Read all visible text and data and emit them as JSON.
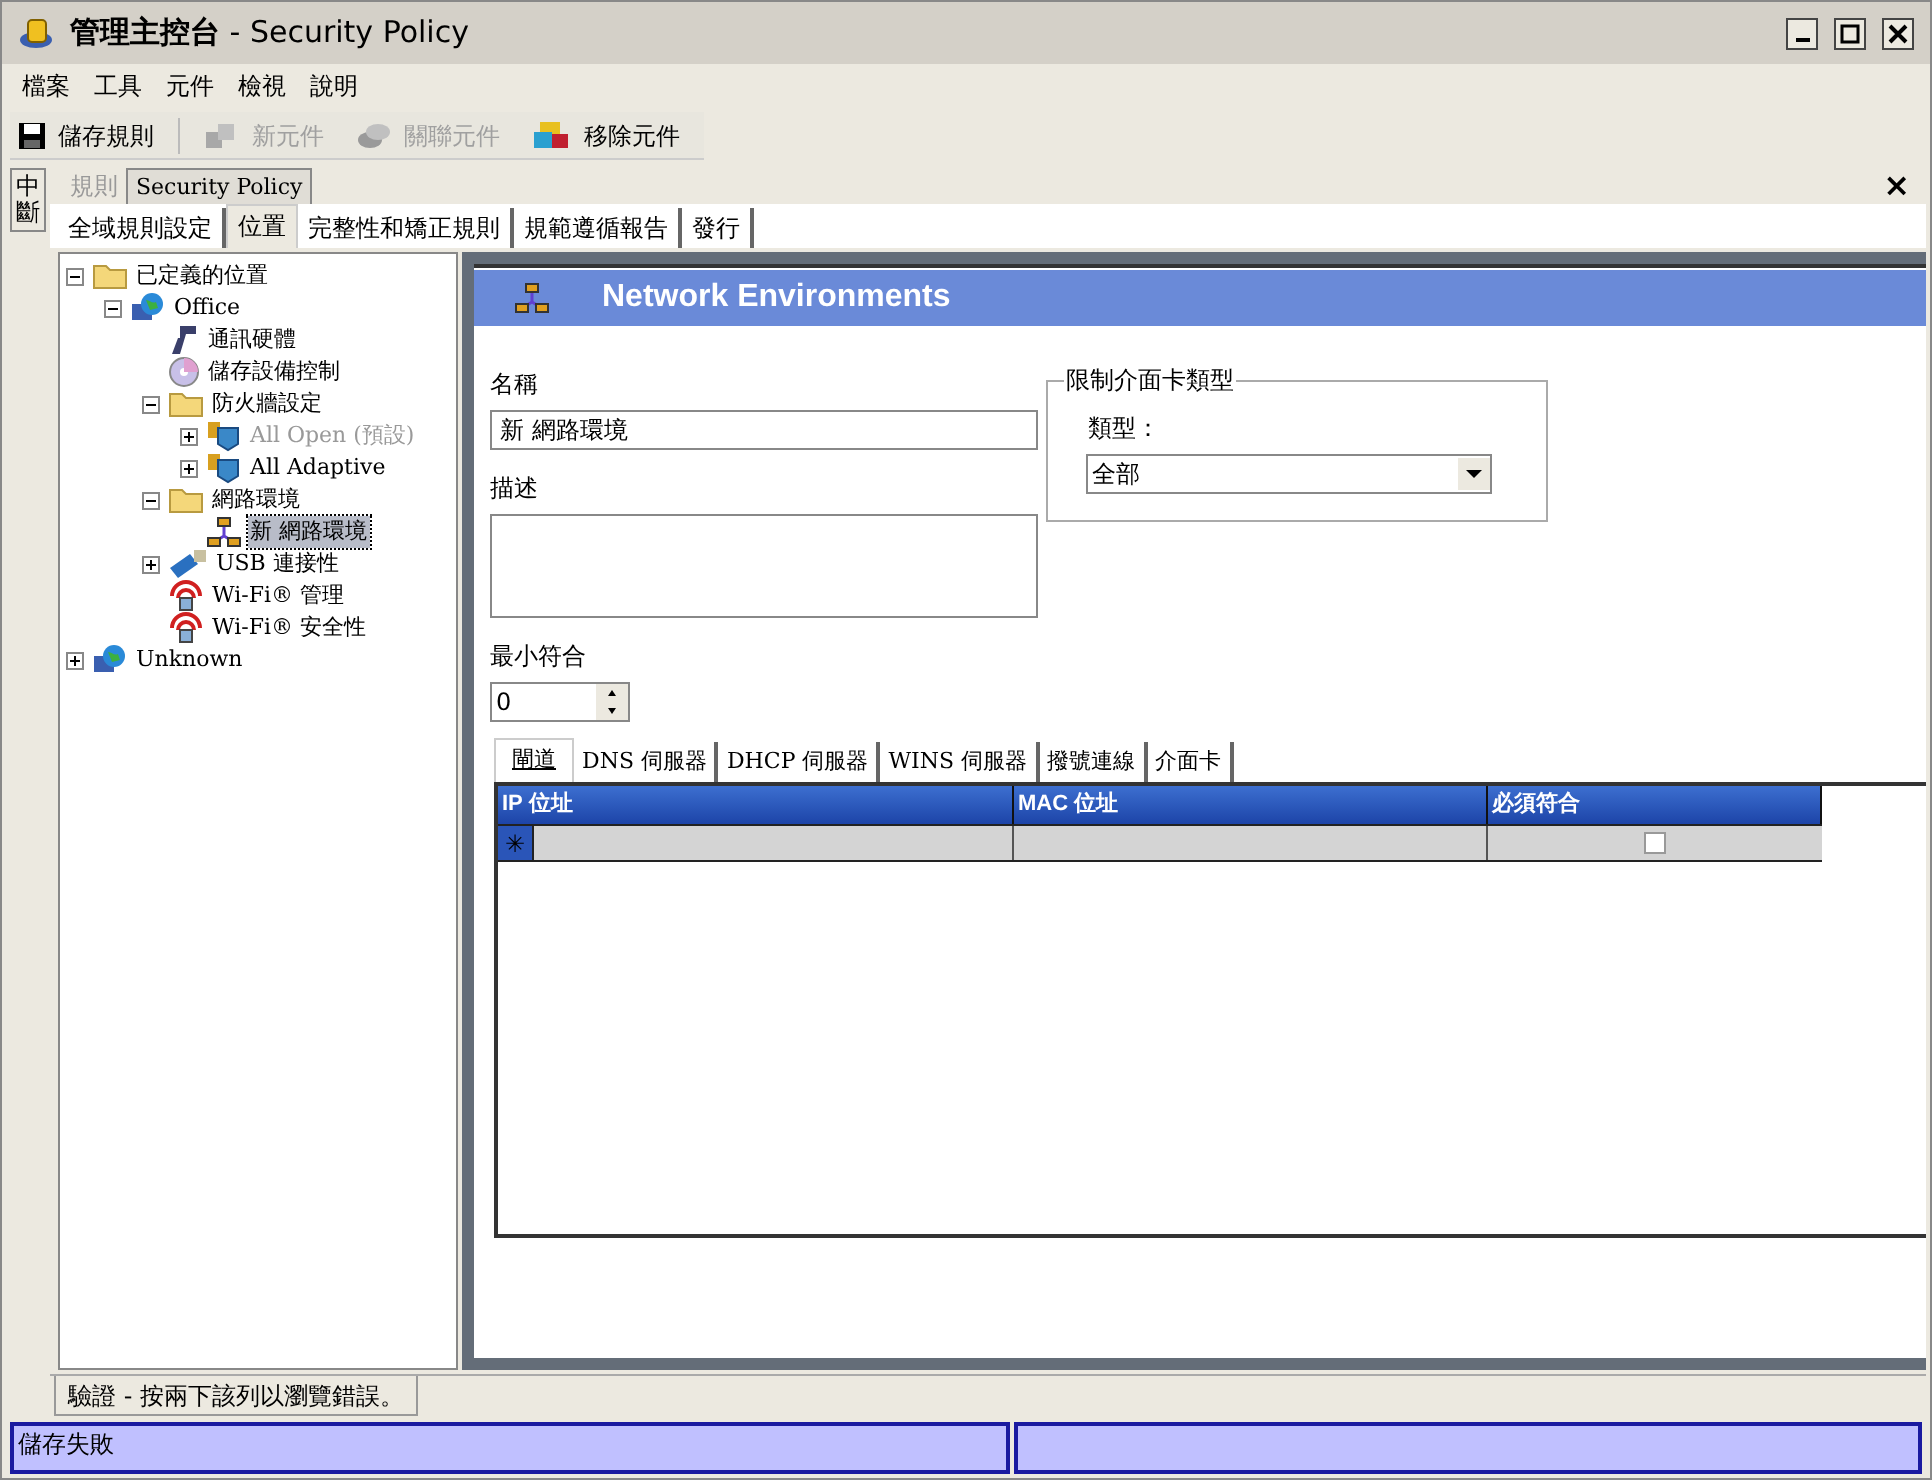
{
  "window": {
    "title_main": "管理主控台",
    "title_rest": "- Security Policy"
  },
  "menu": [
    "檔案",
    "工具",
    "元件",
    "檢視",
    "說明"
  ],
  "toolbar": [
    {
      "kind": "save",
      "label": "儲存規則",
      "disabled": false
    },
    {
      "kind": "new",
      "label": "新元件",
      "disabled": true
    },
    {
      "kind": "link",
      "label": "關聯元件",
      "disabled": true
    },
    {
      "kind": "remove",
      "label": "移除元件",
      "disabled": false
    }
  ],
  "side_tab": "中斷",
  "document_tabs": [
    {
      "label": "規則",
      "selected": false
    },
    {
      "label": "Security Policy",
      "selected": true
    }
  ],
  "close_glyph": "×",
  "tabs": [
    {
      "label": "全域規則設定",
      "selected": false
    },
    {
      "label": "位置",
      "selected": true
    },
    {
      "label": "完整性和矯正規則",
      "selected": false
    },
    {
      "label": "規範遵循報告",
      "selected": false
    },
    {
      "label": "發行",
      "selected": false
    }
  ],
  "tree": [
    {
      "kind": "folder",
      "label": "已定義的位置",
      "expanded": true,
      "selected": false,
      "disabled": false,
      "children": [
        {
          "kind": "globe",
          "label": "Office",
          "expanded": true,
          "selected": false,
          "disabled": false,
          "children": [
            {
              "kind": "device",
              "label": "通訊硬體",
              "selected": false,
              "disabled": false
            },
            {
              "kind": "disc",
              "label": "儲存設備控制",
              "selected": false,
              "disabled": false
            },
            {
              "kind": "folder",
              "label": "防火牆設定",
              "expanded": true,
              "selected": false,
              "disabled": false,
              "children": [
                {
                  "kind": "firewall",
                  "label": "All Open (預設)",
                  "expanded": false,
                  "selected": false,
                  "disabled": true
                },
                {
                  "kind": "firewall",
                  "label": "All Adaptive",
                  "expanded": false,
                  "selected": false,
                  "disabled": false
                }
              ]
            },
            {
              "kind": "folder",
              "label": "網路環境",
              "expanded": true,
              "selected": false,
              "disabled": false,
              "children": [
                {
                  "kind": "network",
                  "label": "新 網路環境",
                  "selected": true,
                  "disabled": false
                }
              ]
            },
            {
              "kind": "usb",
              "label": "USB 連接性",
              "expanded": false,
              "selected": false,
              "disabled": false
            },
            {
              "kind": "wifi",
              "label": "Wi-Fi® 管理",
              "selected": false,
              "disabled": false
            },
            {
              "kind": "wifi",
              "label": "Wi-Fi® 安全性",
              "selected": false,
              "disabled": false
            }
          ]
        }
      ]
    },
    {
      "kind": "globe",
      "label": "Unknown",
      "expanded": false,
      "selected": false,
      "disabled": false
    }
  ],
  "panel": {
    "title": "Network Environments",
    "name_label": "名稱",
    "name_value": "新 網路環境",
    "description_label": "描述",
    "min_match_label": "最小符合",
    "min_match_value": "0",
    "nic_group": {
      "title": "限制介面卡類型",
      "type_label": "類型：",
      "type_value": "全部"
    },
    "sub_tabs": [
      {
        "label": "閘道",
        "selected": true
      },
      {
        "label": "DNS 伺服器",
        "selected": false
      },
      {
        "label": "DHCP 伺服器",
        "selected": false
      },
      {
        "label": "WINS 伺服器",
        "selected": false
      },
      {
        "label": "撥號連線",
        "selected": false
      },
      {
        "label": "介面卡",
        "selected": false
      }
    ],
    "grid": {
      "columns": [
        "IP 位址",
        "MAC 位址",
        "必須符合"
      ],
      "new_row_glyph": "✳",
      "required_checked": false
    }
  },
  "bottom_tab": "驗證 - 按兩下該列以瀏覽錯誤。",
  "status_bar": {
    "message": "儲存失敗"
  }
}
